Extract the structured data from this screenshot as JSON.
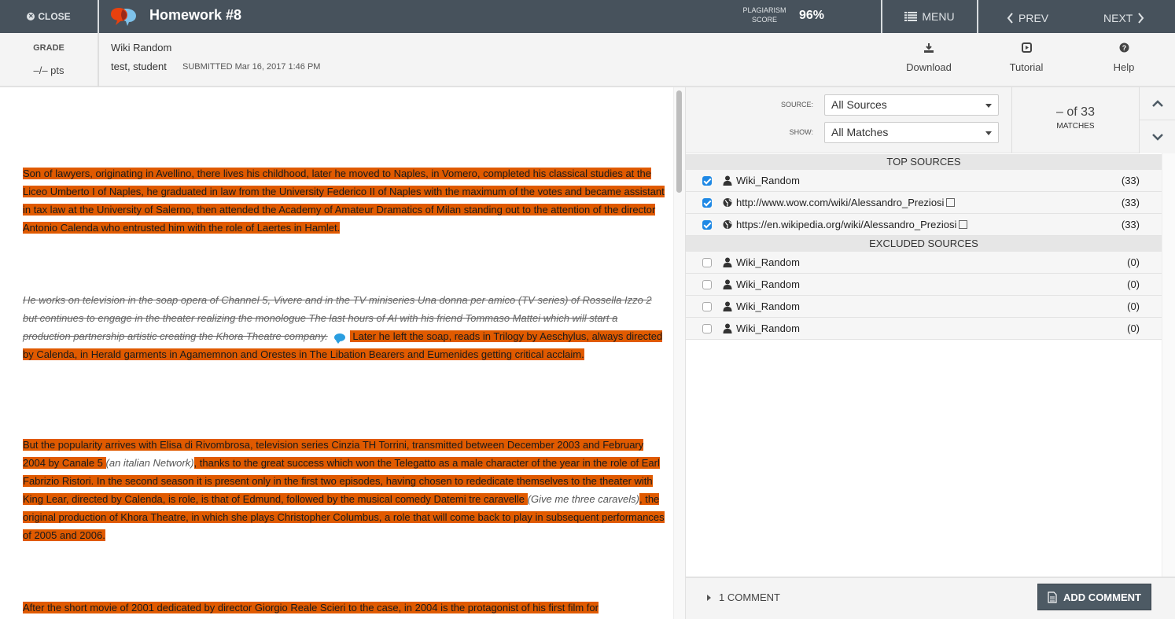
{
  "topbar": {
    "close_label": "CLOSE",
    "title": "Homework #8",
    "plagiarism_label_line1": "PLAGIARISM",
    "plagiarism_label_line2": "SCORE",
    "plagiarism_score": "96%",
    "menu_label": "MENU",
    "prev_label": "PREV",
    "next_label": "NEXT",
    "colors": {
      "bar": "#47525c",
      "logo_left": "#e8410e",
      "logo_right": "#7ec2ea"
    }
  },
  "subheader": {
    "grade_label": "GRADE",
    "grade_value": "–/– pts",
    "assignment_name": "Wiki Random",
    "student_name": "test, student",
    "submitted_text": "SUBMITTED Mar 16, 2017 1:46 PM",
    "tools": [
      {
        "label": "Download",
        "icon": "download-icon"
      },
      {
        "label": "Tutorial",
        "icon": "play-box-icon"
      },
      {
        "label": "Help",
        "icon": "question-circle-icon"
      }
    ]
  },
  "document": {
    "highlight_color": "#e05a00",
    "p1": " Son of lawyers, originating in Avellino, there lives his childhood, later he moved to Naples, in Vomero, completed his classical studies at the Liceo Umberto I of Naples, he graduated in law from the University Federico II of Naples with the maximum of the votes and became assistant in tax law at the University of Salerno, then attended the Academy of Amateur Dramatics of Milan standing out to the attention of the director Antonio Calenda who entrusted him with the role of Laertes in Hamlet.",
    "p2_excluded": " He works on television in the soap opera of Channel 5, Vivere and in the TV miniseries Una donna per amico (TV series) of Rossella Izzo 2 but continues to engage in the theater realizing the monologue The last hours of AI with his friend Tommaso Mattei which will start a production partnership artistic creating the Khora Theatre company.",
    "p2_match": " Later he left the soap, reads in Trilogy by Aeschylus, always directed by Calenda, in Herald garments in Agamemnon and Orestes in The Libation Bearers and Eumenides getting critical acclaim.",
    "p3_a": " But the popularity arrives with Elisa di Rivombrosa, television series Cinzia TH Torrini, transmitted between December 2003 and February 2004 by Canale 5 ",
    "p3_note1": "(an italian Network)",
    "p3_b": ", thanks to the great success which won the Telegatto as a male character of the year in the role of Earl Fabrizio Ristori.",
    "p3_c": "   In the second season it is present only in the first two episodes, having chosen to rededicate themselves to the theater with King Lear, directed by Calenda, is role, is that of Edmund, followed by the musical comedy Datemi tre caravelle ",
    "p3_note2": "(Give me three caravels)",
    "p3_d": ", the original production of Khora Theatre, in which she plays Christopher Columbus, a role that will come back to play in subsequent performances of 2005 and 2006.",
    "p4": " After the short movie of 2001 dedicated by director Giorgio Reale Scieri to the case, in 2004 is the protagonist of his first film for"
  },
  "panel": {
    "source_label": "SOURCE:",
    "source_value": "All Sources",
    "show_label": "SHOW:",
    "show_value": "All Matches",
    "match_position": "– of 33",
    "matches_label": "MATCHES",
    "top_sources_header": "TOP SOURCES",
    "excluded_sources_header": "EXCLUDED SOURCES",
    "top_sources": [
      {
        "name": "Wiki_Random",
        "count": "(33)",
        "checked": true,
        "type": "user",
        "external": false
      },
      {
        "name": "http://www.wow.com/wiki/Alessandro_Preziosi",
        "count": "(33)",
        "checked": true,
        "type": "web",
        "external": true
      },
      {
        "name": "https://en.wikipedia.org/wiki/Alessandro_Preziosi",
        "count": "(33)",
        "checked": true,
        "type": "web",
        "external": true
      }
    ],
    "excluded_sources": [
      {
        "name": "Wiki_Random",
        "count": "(0)",
        "checked": false,
        "type": "user"
      },
      {
        "name": "Wiki_Random",
        "count": "(0)",
        "checked": false,
        "type": "user"
      },
      {
        "name": "Wiki_Random",
        "count": "(0)",
        "checked": false,
        "type": "user"
      },
      {
        "name": "Wiki_Random",
        "count": "(0)",
        "checked": false,
        "type": "user"
      }
    ],
    "comment_toggle_label": "1 COMMENT",
    "add_comment_label": "ADD COMMENT"
  }
}
